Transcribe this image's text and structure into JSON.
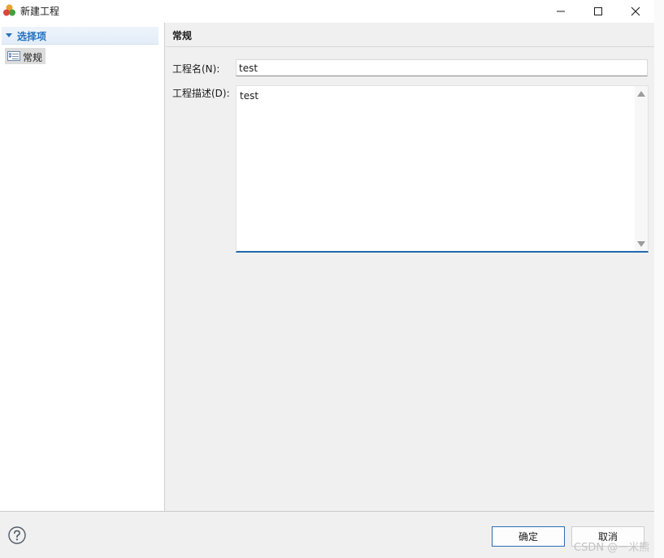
{
  "window": {
    "title": "新建工程",
    "icon": "app-logo-icon",
    "controls": [
      "minimize-icon",
      "maximize-icon",
      "close-icon"
    ]
  },
  "tree": {
    "root_label": "选择项",
    "items": [
      {
        "label": "常规",
        "icon": "list-page-icon",
        "selected": true
      }
    ]
  },
  "content": {
    "title": "常规",
    "name_label": "工程名(N):",
    "name_value": "test",
    "desc_label": "工程描述(D):",
    "desc_value": "test"
  },
  "footer": {
    "help_icon": "help-icon",
    "ok_label": "确定",
    "cancel_label": "取消",
    "watermark": "CSDN @一米熊"
  },
  "colors": {
    "accent": "#1f6ab0",
    "tree_root_text": "#1f6fc0"
  }
}
